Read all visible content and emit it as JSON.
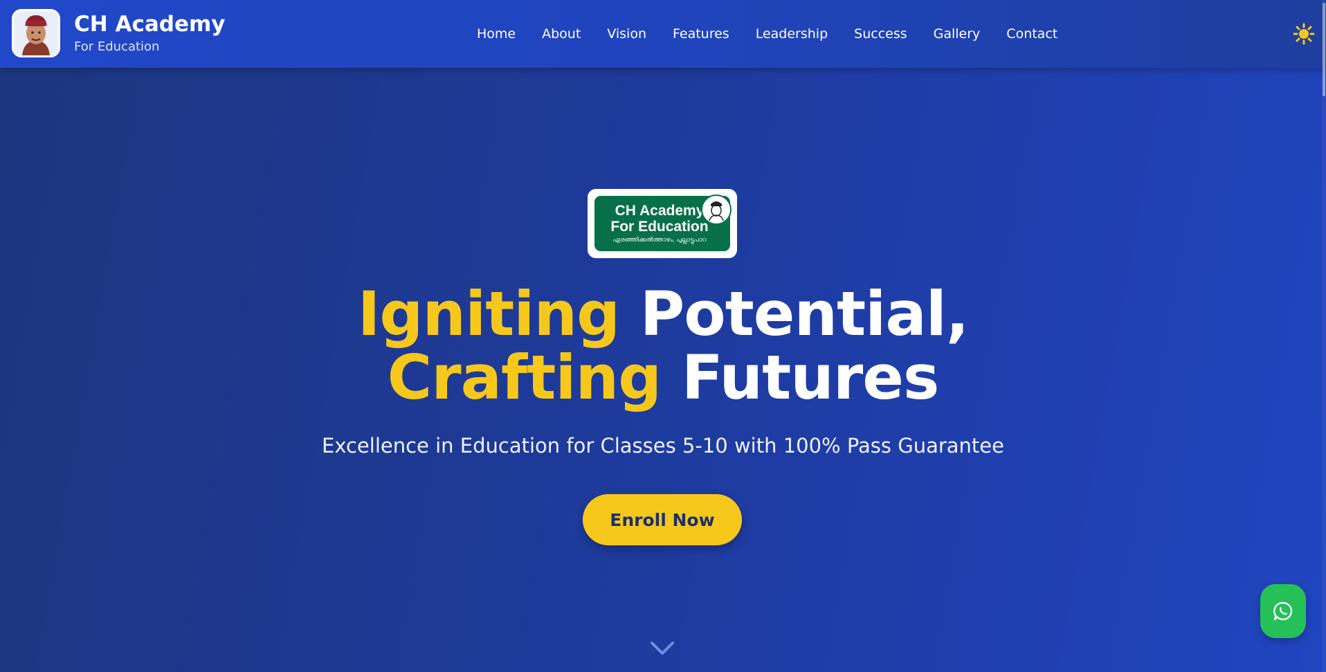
{
  "header": {
    "brand_title": "CH Academy",
    "brand_subtitle": "For Education",
    "nav": [
      "Home",
      "About",
      "Vision",
      "Features",
      "Leadership",
      "Success",
      "Gallery",
      "Contact"
    ],
    "theme_icon": "sun-icon"
  },
  "hero": {
    "logo": {
      "line1": "CH Academy",
      "line2": "For Education",
      "line3": "എരഞ്ഞിക്കൽത്താഴം, പുല്ലാട്ടുപാറ"
    },
    "headline": {
      "word1": "Igniting",
      "word2": "Potential,",
      "word3": "Crafting",
      "word4": "Futures"
    },
    "tagline": "Excellence in Education for Classes 5-10 with 100% Pass Guarantee",
    "cta_label": "Enroll Now",
    "scroll_icon": "chevron-down-icon"
  },
  "floating": {
    "whatsapp_icon": "whatsapp-icon"
  },
  "colors": {
    "accent_yellow": "#f6c81b",
    "header_blue": "#2148c9",
    "background_blue": "#1e3a9a",
    "logo_green": "#07704a",
    "whatsapp_green": "#25c057"
  }
}
